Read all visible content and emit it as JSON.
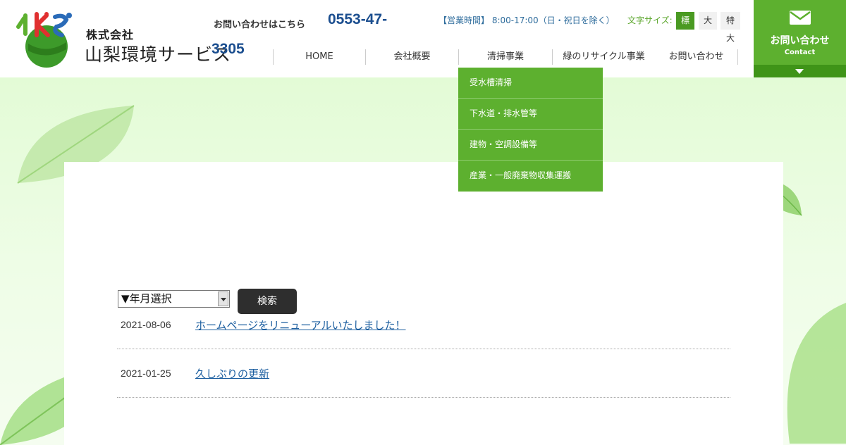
{
  "header": {
    "company_small": "株式会社",
    "company_name": "山梨環境サービス",
    "inquiry_label": "お問い合わせはこちら",
    "phone_line1": "0553-47-",
    "phone_line2": "3305",
    "hours": "【営業時間】 8:00-17:00（日・祝日を除く）",
    "font_size_label": "文字サイズ:",
    "font_sizes": [
      "標準",
      "大",
      "特大"
    ]
  },
  "nav": {
    "items": [
      "HOME",
      "会社概要",
      "清掃事業",
      "緑のリサイクル事業",
      "お問い合わせ"
    ]
  },
  "contact": {
    "label": "お問い合わせ",
    "sub": "Contact",
    "icon": "mail-icon"
  },
  "dropdown": {
    "items": [
      "受水槽清掃",
      "下水道・排水管等",
      "建物・空調設備等",
      "産業・一般廃棄物収集運搬"
    ]
  },
  "archive": {
    "select_value": "▼年月選択",
    "search_label": "検索"
  },
  "news": [
    {
      "date": "2021-08-06",
      "title": "ホームページをリニューアルいたしました！"
    },
    {
      "date": "2021-01-25",
      "title": "久しぶりの更新"
    }
  ],
  "colors": {
    "accent_green": "#5db02f",
    "phone_blue": "#1b4e8f",
    "link_blue": "#1d5fa0"
  }
}
